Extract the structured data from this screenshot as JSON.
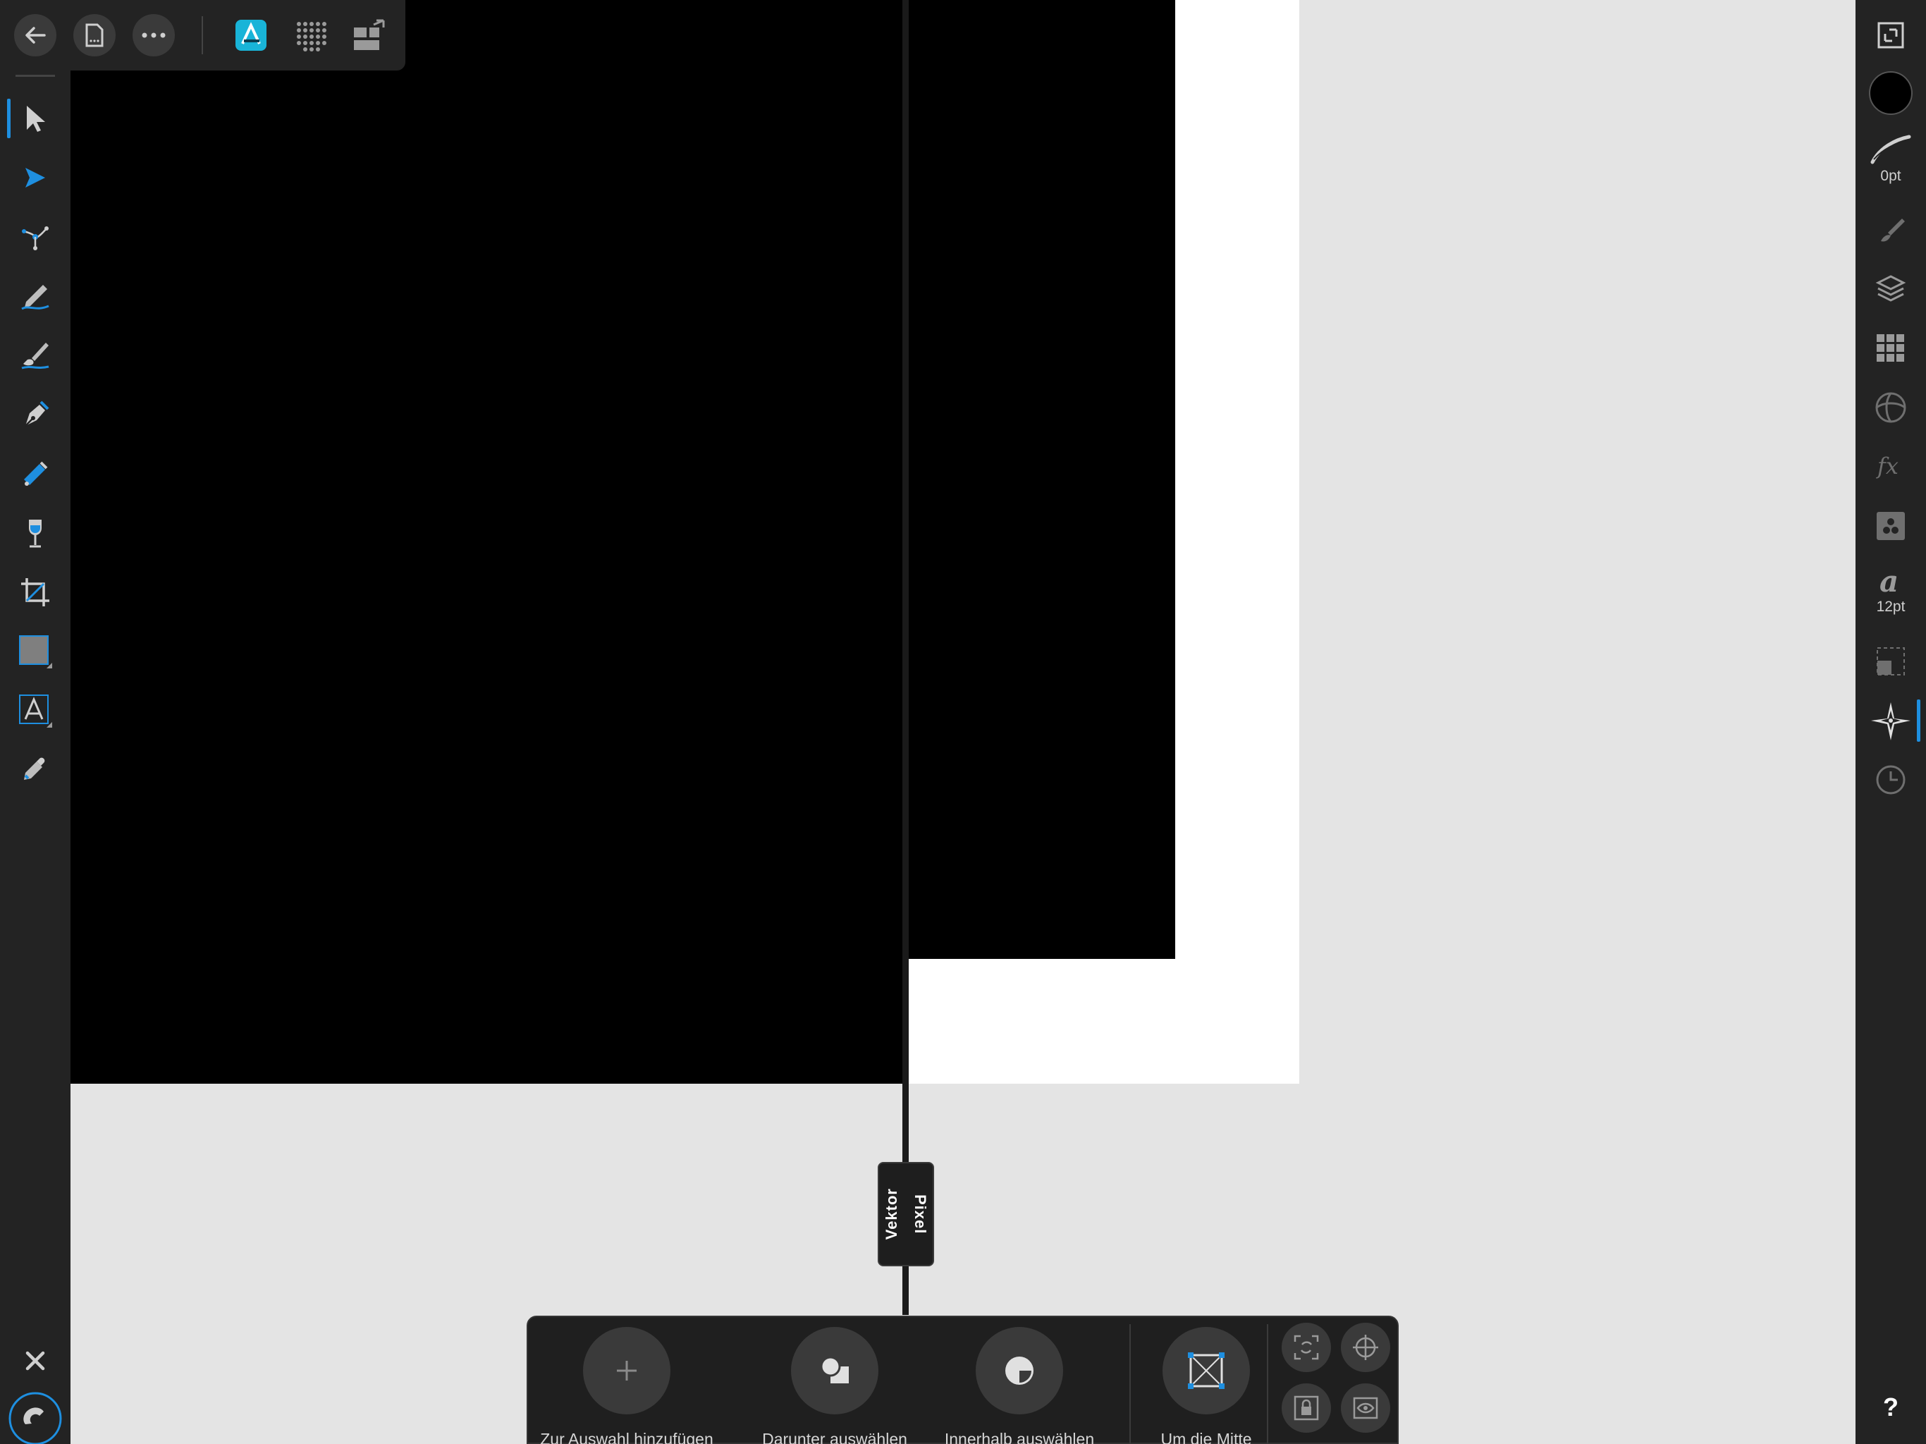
{
  "split_view": {
    "vector_label": "Vektor",
    "pixel_label": "Pixel"
  },
  "topbar": {
    "icons": [
      "back-arrow-icon",
      "document-icon",
      "more-icon",
      "designer-persona-icon",
      "pixel-persona-icon",
      "export-persona-icon"
    ],
    "accent_color": "#19b4d8"
  },
  "left_tools": [
    "move-tool-icon",
    "node-tool-icon",
    "corner-tool-icon",
    "pencil-tool-icon",
    "vector-brush-tool-icon",
    "pen-tool-icon",
    "fill-tool-icon",
    "transparency-tool-icon",
    "crop-tool-icon",
    "rectangle-tool-icon",
    "artistic-text-tool-icon",
    "color-picker-tool-icon"
  ],
  "right_studio": {
    "stroke_width": "0pt",
    "font_size": "12pt",
    "help": "?"
  },
  "context_toolbar": {
    "add_to_selection": "Zur Auswahl hinzufügen",
    "select_under": "Darunter auswählen",
    "select_inside": "Innerhalb auswählen",
    "rotate_center": "Um die Mitte"
  },
  "colors": {
    "ui_dark": "#232323",
    "accent_blue": "#1e8fe0",
    "canvas_bg": "#e4e4e4"
  }
}
